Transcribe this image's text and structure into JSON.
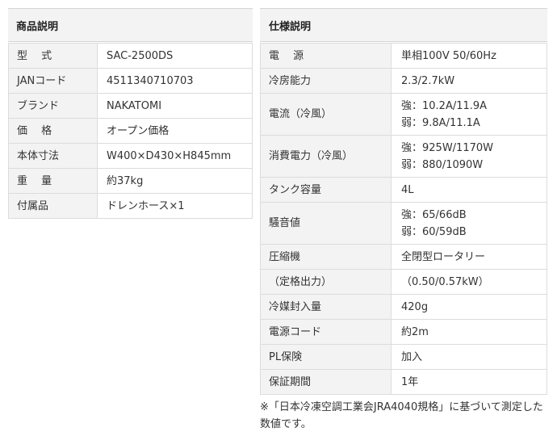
{
  "product": {
    "heading": "商品説明",
    "rows": [
      {
        "label": "型　 式",
        "value": "SAC-2500DS"
      },
      {
        "label": "JANコード",
        "value": "4511340710703"
      },
      {
        "label": "ブランド",
        "value": "NAKATOMI"
      },
      {
        "label": "価　 格",
        "value": "オープン価格"
      },
      {
        "label": "本体寸法",
        "value": "W400×D430×H845mm"
      },
      {
        "label": "重　 量",
        "value": "約37kg"
      },
      {
        "label": "付属品",
        "value": "ドレンホース×1"
      }
    ]
  },
  "spec": {
    "heading": "仕様説明",
    "rows": [
      {
        "label": "電　 源",
        "values": [
          "単相100V 50/60Hz"
        ]
      },
      {
        "label": "冷房能力",
        "values": [
          "2.3/2.7kW"
        ]
      },
      {
        "label": "電流（冷風）",
        "values": [
          "強：10.2A/11.9A",
          "弱：9.8A/11.1A"
        ]
      },
      {
        "label": "消費電力（冷風）",
        "values": [
          "強：925W/1170W",
          "弱：880/1090W"
        ]
      },
      {
        "label": "タンク容量",
        "values": [
          "4L"
        ]
      },
      {
        "label": "騒音値",
        "values": [
          "強：65/66dB",
          "弱：60/59dB"
        ]
      },
      {
        "label": "圧縮機",
        "values": [
          "全閉型ロータリー"
        ]
      },
      {
        "label": "（定格出力）",
        "values": [
          "（0.50/0.57kW）"
        ]
      },
      {
        "label": "冷媒封入量",
        "values": [
          "420g"
        ]
      },
      {
        "label": "電源コード",
        "values": [
          "約2m"
        ]
      },
      {
        "label": "PL保険",
        "values": [
          "加入"
        ]
      },
      {
        "label": "保証期間",
        "values": [
          "1年"
        ]
      }
    ]
  },
  "note": "※「日本冷凍空調工業会JRA4040規格」に基づいて測定した数値です。"
}
